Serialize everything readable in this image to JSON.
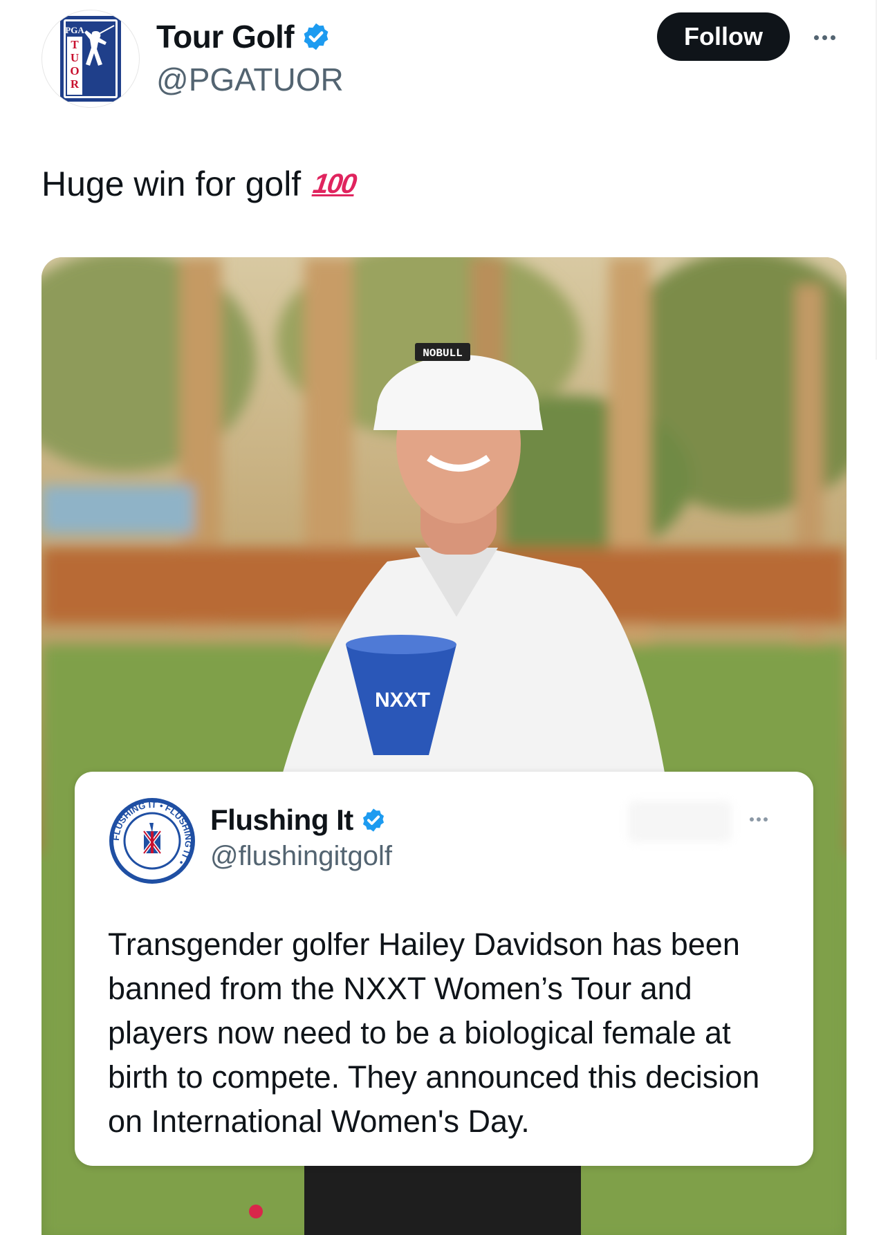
{
  "tweet": {
    "author_name": "Tour Golf",
    "author_handle": "@PGATUOR",
    "follow_label": "Follow",
    "text": "Huge win for golf",
    "emoji": "100",
    "avatar_letters": [
      "PGA",
      "T",
      "U",
      "O",
      "R"
    ]
  },
  "media": {
    "cap_text": "NOBULL",
    "trophy_text": "NXXT"
  },
  "quoted": {
    "author_name": "Flushing It",
    "author_handle": "@flushingitgolf",
    "avatar_ring_text": "FLUSHING IT • FLUSHING IT •",
    "text": "Transgender golfer Hailey Davidson has been banned from the NXXT Women’s Tour and players now need to be a biological female at birth to compete. They announced this decision on International Women's Day."
  },
  "colors": {
    "verified": "#1d9bf0",
    "follow_bg": "#0f1419",
    "pga_blue": "#1f3f8a",
    "pga_red": "#c8102e"
  },
  "icons": [
    "verified-badge-icon",
    "more-options-icon"
  ]
}
